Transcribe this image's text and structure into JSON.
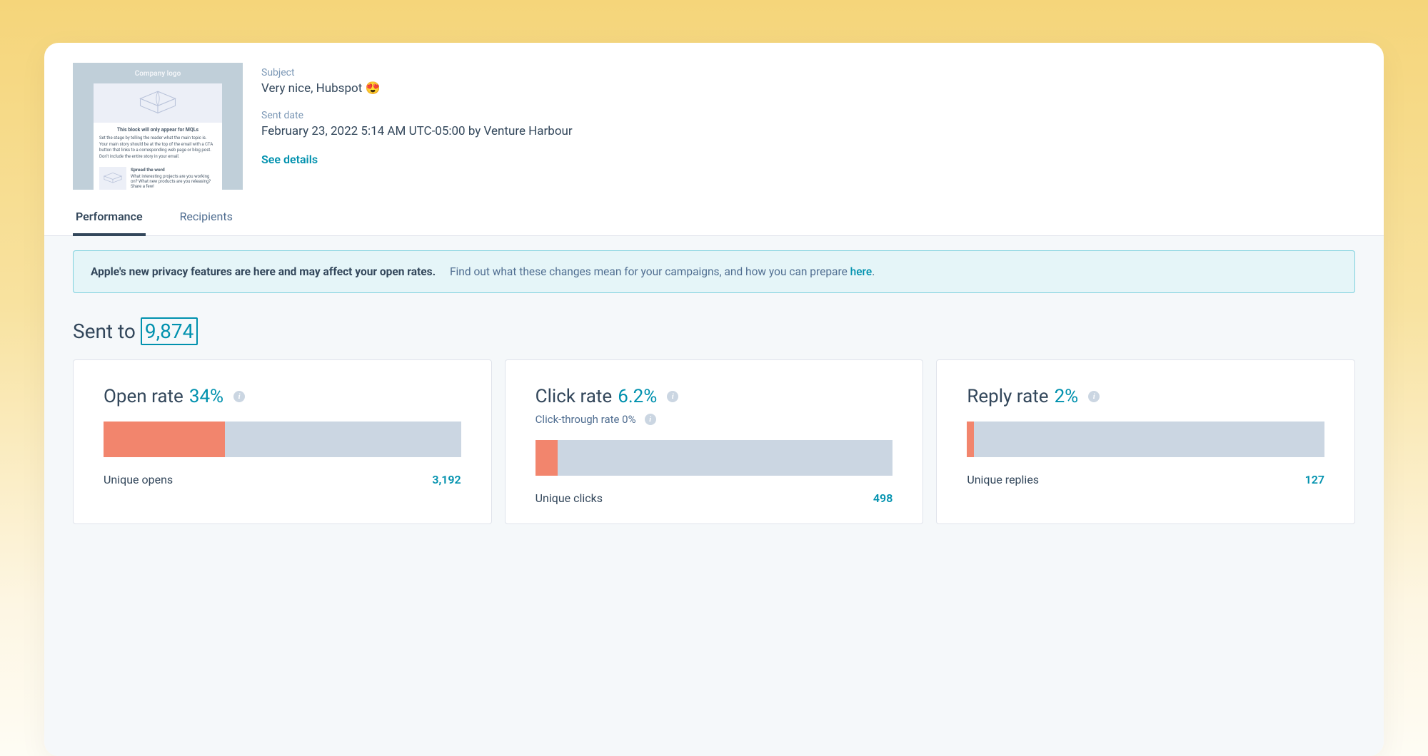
{
  "thumbnail": {
    "logo_text": "Company logo",
    "block_title": "This block will only appear for MQLs",
    "block_body": "Set the stage by telling the reader what the main topic is. Your main story should be at the top of the email with a CTA button that links to a corresponding web page or blog post. Don't include the entire story in your email.",
    "spread_title": "Spread the word",
    "spread_body": "What interesting projects are you working on? What new products are you releasing? Share a few!"
  },
  "meta": {
    "subject_label": "Subject",
    "subject_value": "Very nice, Hubspot 😍",
    "sent_label": "Sent date",
    "sent_value": "February 23, 2022 5:14 AM UTC-05:00 by Venture Harbour",
    "see_details": "See details"
  },
  "tabs": [
    {
      "label": "Performance",
      "active": true
    },
    {
      "label": "Recipients",
      "active": false
    }
  ],
  "notice": {
    "bold": "Apple's new privacy features are here and may affect your open rates.",
    "text": "Find out what these changes mean for your campaigns, and how you can prepare ",
    "link": "here",
    "period": "."
  },
  "sent_to": {
    "label": "Sent to ",
    "count": "9,874"
  },
  "chart_data": [
    {
      "type": "bar",
      "title": "Open rate",
      "pct_label": "34%",
      "fill_pct": 34,
      "unique_label": "Unique opens",
      "unique_value": "3,192",
      "subline": null
    },
    {
      "type": "bar",
      "title": "Click rate",
      "pct_label": "6.2%",
      "fill_pct": 6.2,
      "unique_label": "Unique clicks",
      "unique_value": "498",
      "subline": "Click-through rate 0%"
    },
    {
      "type": "bar",
      "title": "Reply rate",
      "pct_label": "2%",
      "fill_pct": 2,
      "unique_label": "Unique replies",
      "unique_value": "127",
      "subline": null
    }
  ]
}
